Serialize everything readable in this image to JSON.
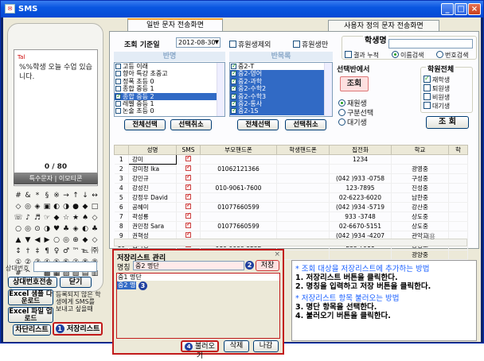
{
  "window": {
    "title": "SMS"
  },
  "phone": {
    "tag": "Tal",
    "message": "%%학생 오늘 수업 있습니다.",
    "count": "0 / 80",
    "special_chars_bar": "특수문자 | 이모티콘",
    "symbols": [
      "#",
      "&",
      "*",
      "§",
      "※",
      "→",
      "↑",
      "↓",
      "↔",
      "◇",
      "◎",
      "◈",
      "▣",
      "◐",
      "◑",
      "●",
      "◆",
      "□",
      "☏",
      "♪",
      "♬",
      "☞",
      "◆",
      "☆",
      "★",
      "♠",
      "◇",
      "○",
      "◎",
      "⊙",
      "◑",
      "♥",
      "♣",
      "◈",
      "◐",
      "♣",
      "▲",
      "▼",
      "◀",
      "▶",
      "○",
      "◎",
      "⊕",
      "◆",
      "◇",
      "↕",
      "†",
      "‡",
      "¶",
      "♀",
      "♂",
      "™",
      "℡",
      "㈜",
      "①",
      "②",
      "③",
      "④",
      "⑤",
      "⑥",
      "⑦",
      "⑧",
      "⑨",
      "#",
      "^",
      "°",
      "▩",
      "▦",
      "▨",
      "▧",
      "▤",
      "▥"
    ],
    "recipient_label": "상대번호",
    "send_button": "상대번호전송",
    "close_button": "닫기",
    "excel_download": "Excel 샘플 다운로드",
    "excel_upload": "Excel 파일 업로드",
    "unregistered_note": "등록되지 않은 학생에게 SMS를 보내고 싶을때",
    "block_list_button": "차단리스트",
    "save_list_button": "저장리스트",
    "save_list_badge": "1"
  },
  "tabs": [
    {
      "label": "일반 문자 전송화면"
    },
    {
      "label": "사용자 정의 문자 전송화면"
    }
  ],
  "filters": {
    "date_label": "조회 기준일",
    "date_value": "2012-08-30",
    "exclude_leave": "휴원생제외",
    "leave_only": "휴원생만",
    "class_header": "반명",
    "grade_header": "반목록",
    "select_all": "전체선택",
    "deselect": "선택취소",
    "search_button": "조회",
    "student_name_label": "학생명",
    "result_accumulate": "결과 누적",
    "search_by": [
      "이름검색",
      "번호검색"
    ],
    "selection_label": "선택반에서",
    "target_options": [
      "재원생",
      "구분선택",
      "대기생"
    ],
    "all_students_label": "학원전체",
    "status_options": [
      {
        "label": "재학생",
        "checked": true
      },
      {
        "label": "퇴원생",
        "checked": false
      },
      {
        "label": "비원생",
        "checked": false
      },
      {
        "label": "대기생",
        "checked": false
      }
    ],
    "right_search_button": "조 회"
  },
  "class_list": [
    {
      "label": "고등 이래",
      "checked": false,
      "selected": false
    },
    {
      "label": "향아 특강 초중고",
      "checked": false,
      "selected": false
    },
    {
      "label": "정폭 초등 0",
      "checked": false,
      "selected": false
    },
    {
      "label": "종합 중등 1",
      "checked": false,
      "selected": false
    },
    {
      "label": "종합 중등 2",
      "checked": true,
      "selected": true
    },
    {
      "label": "레벨 중등 1",
      "checked": false,
      "selected": false
    },
    {
      "label": "논술 초등 0",
      "checked": false,
      "selected": false
    }
  ],
  "grade_list": [
    {
      "label": "중2-T",
      "checked": true,
      "selected": false
    },
    {
      "label": "중2-영어",
      "checked": true,
      "selected": true
    },
    {
      "label": "중2-과학",
      "checked": true,
      "selected": true
    },
    {
      "label": "중2-수학2",
      "checked": true,
      "selected": true
    },
    {
      "label": "중2-수학3",
      "checked": true,
      "selected": true
    },
    {
      "label": "중2-통사",
      "checked": true,
      "selected": true
    },
    {
      "label": "중2-1S",
      "checked": true,
      "selected": true
    }
  ],
  "table": {
    "columns": [
      "",
      "성명",
      "SMS",
      "부모핸드폰",
      "학생핸드폰",
      "집전화",
      "학교",
      "학"
    ],
    "rows": [
      [
        "1",
        "강미",
        "",
        "",
        "",
        "1234",
        ""
      ],
      [
        "2",
        "강미정 Ika",
        "",
        "01062121366",
        "",
        "",
        "광영중"
      ],
      [
        "3",
        "강민규",
        "",
        "",
        "",
        "(042 )933 -0758",
        "구성중"
      ],
      [
        "4",
        "강성진",
        "",
        "010-9061-7600",
        "",
        "123-7895",
        "진성중"
      ],
      [
        "5",
        "강정우 David",
        "",
        "",
        "",
        "02-6223-6020",
        "남한중"
      ],
      [
        "6",
        "공혜미",
        "",
        "01077660599",
        "",
        "(042 )934 -5719",
        "강산중"
      ],
      [
        "7",
        "곽성룡",
        "",
        "",
        "",
        "933 -3748",
        "상도중"
      ],
      [
        "8",
        "권민정 Sara",
        "",
        "01077660599",
        "",
        "02-6670-5151",
        "상도중"
      ],
      [
        "9",
        "권혁성",
        "",
        "",
        "",
        "(042 )934 -4207",
        "관악고"
      ],
      [
        "10",
        "김가경",
        "",
        "010-9088-3252",
        "",
        "255-7911",
        "광명고"
      ],
      [
        "11",
        "김기현",
        "",
        "010-9017-1747",
        "",
        "",
        "광양중"
      ]
    ]
  },
  "modal": {
    "title": "저장리스트 관리",
    "name_label": "명칭",
    "name_value": "중2 명단",
    "save_button": "저장",
    "save_badge": "2",
    "list_items": [
      "중1 명단",
      "중2 명단"
    ],
    "list_badge": "3",
    "load_button": "불러오기",
    "load_badge": "4",
    "delete_button": "삭제",
    "exit_button": "나감"
  },
  "right_overflow": {
    "label": "내용"
  },
  "help": {
    "h1": "* 조회 대상을 저장리스트에 추가하는 방법",
    "l1": "1. 저장리스트 버튼을 클릭한다.",
    "l2": "2. 명칭을 입력하고 저장 버튼을 클릭한다.",
    "h2": "* 저장리스트 항목 불러오는 방법",
    "l3": "3. 명단 항목을 선택한다.",
    "l4": "4. 불러오기 버튼을 클릭한다."
  }
}
